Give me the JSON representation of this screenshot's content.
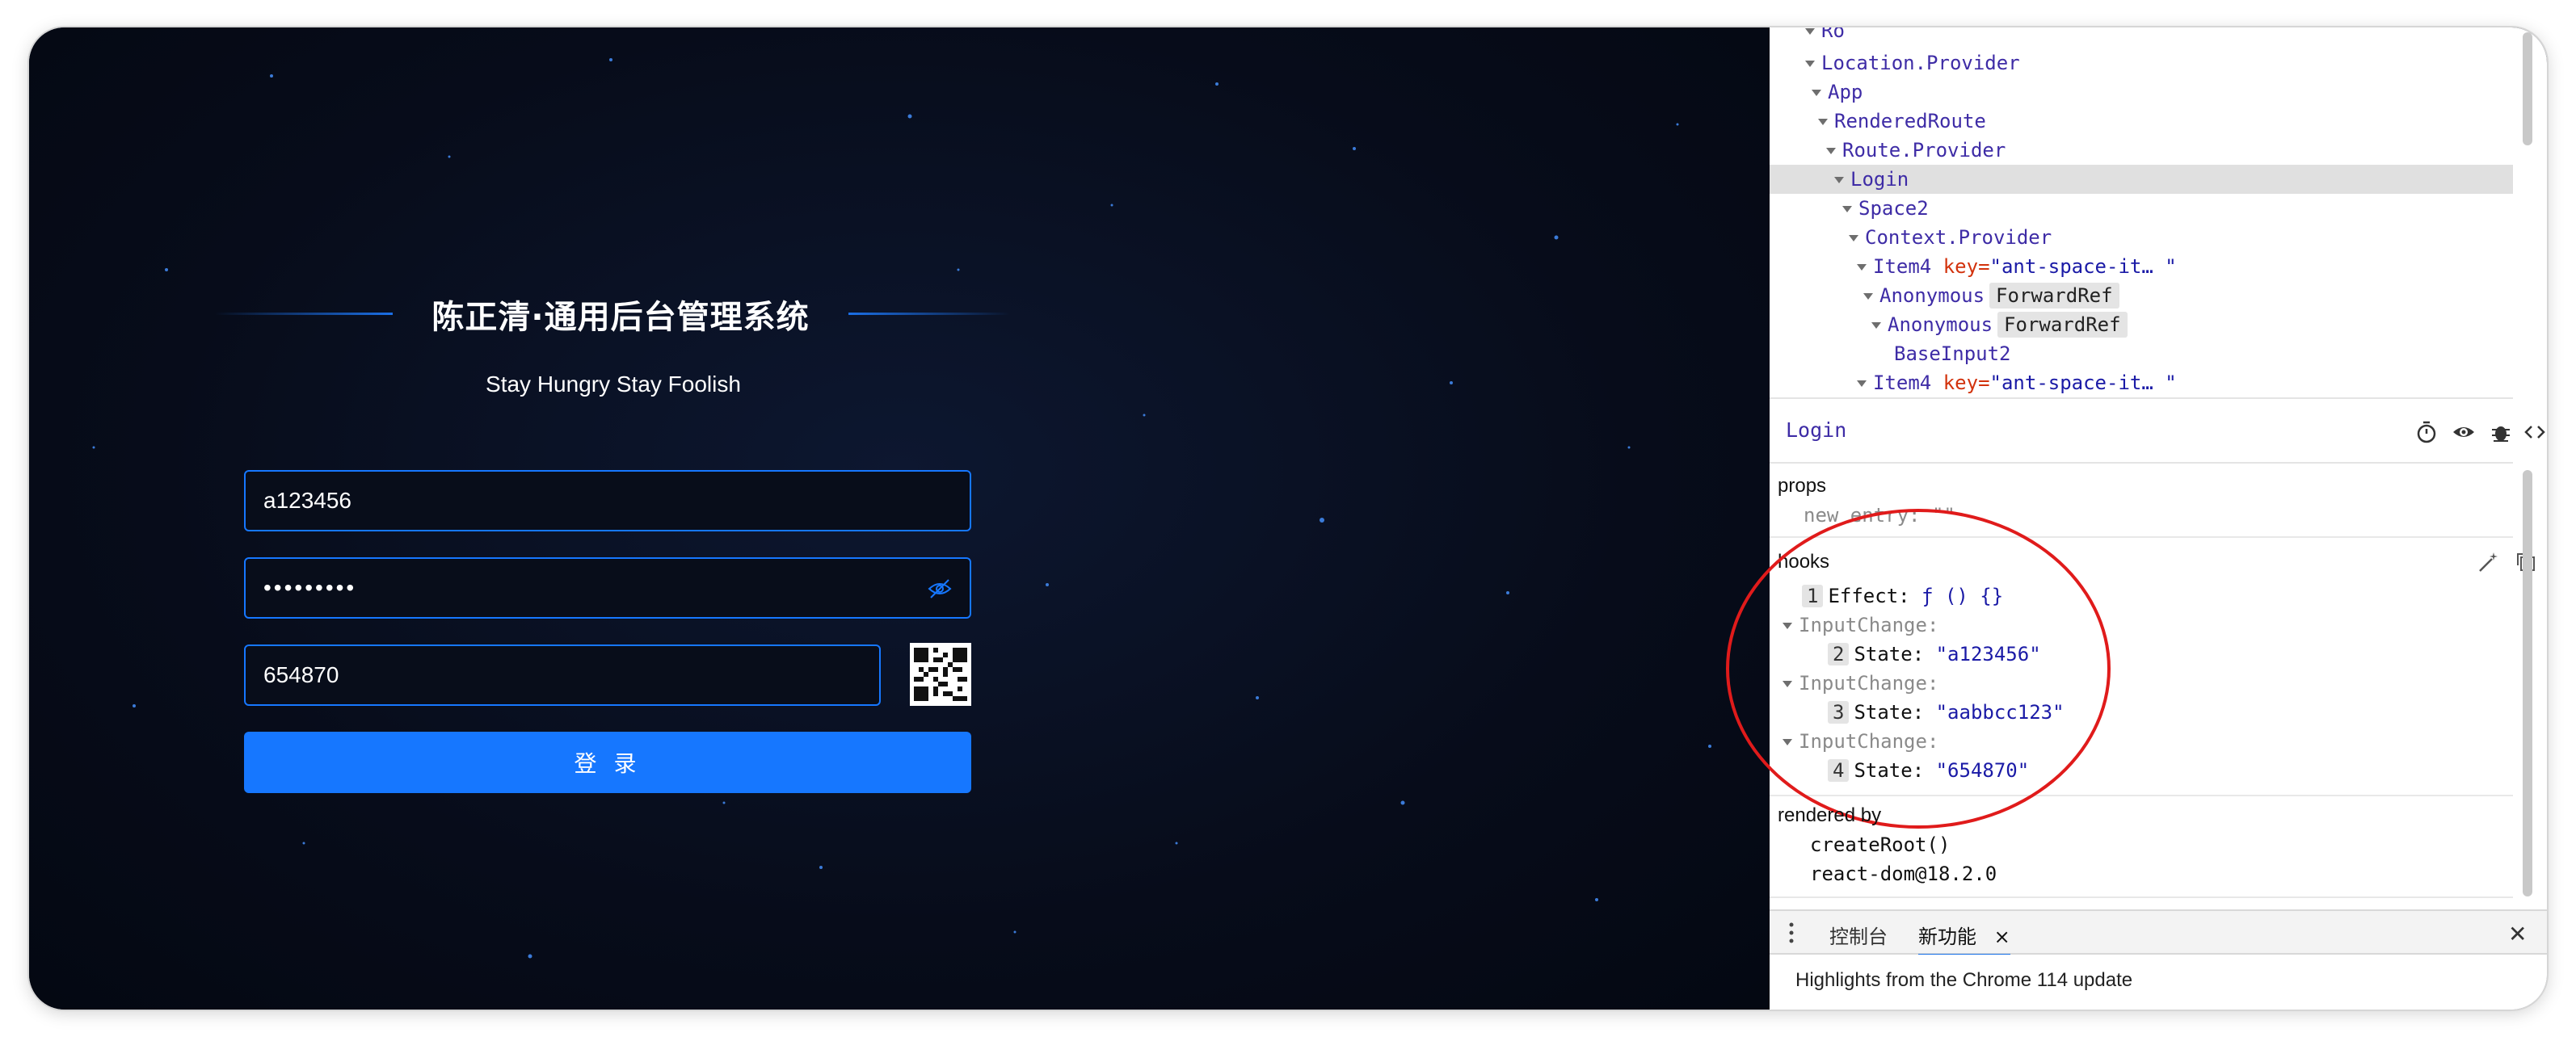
{
  "login": {
    "title": "陈正清·通用后台管理系统",
    "subtitle": "Stay Hungry Stay Foolish",
    "username_value": "a123456",
    "password_mask": "•••••••••",
    "captcha_value": "654870",
    "submit_label": "登 录",
    "accent_color": "#1677ff"
  },
  "devtools": {
    "tree": [
      {
        "label": "Location.Provider"
      },
      {
        "label": "App"
      },
      {
        "label": "RenderedRoute"
      },
      {
        "label": "Route.Provider"
      },
      {
        "label": "Login"
      },
      {
        "label": "Space2"
      },
      {
        "label": "Context.Provider"
      },
      {
        "label": "Item4",
        "key_name": "key",
        "key_value": "\"ant-space-it… \""
      },
      {
        "label": "Anonymous",
        "badge": "ForwardRef"
      },
      {
        "label": "Anonymous",
        "badge": "ForwardRef"
      },
      {
        "label": "BaseInput2"
      },
      {
        "label": "Item4",
        "key_name": "key",
        "key_value": "\"ant-space-it… \""
      }
    ],
    "inspected": {
      "name": "Login",
      "props_label": "props",
      "props_line": "new entry: \"\"",
      "hooks_label": "hooks",
      "hooks": [
        {
          "num": "1",
          "key": "Effect:",
          "value": "ƒ () {}"
        },
        {
          "group": "InputChange:"
        },
        {
          "num": "2",
          "key": "State:",
          "value": "\"a123456\""
        },
        {
          "group": "InputChange:"
        },
        {
          "num": "3",
          "key": "State:",
          "value": "\"aabbcc123\""
        },
        {
          "group": "InputChange:"
        },
        {
          "num": "4",
          "key": "State:",
          "value": "\"654870\""
        }
      ],
      "rendered_by_label": "rendered by",
      "rendered_by": [
        "createRoot()",
        "react-dom@18.2.0"
      ]
    },
    "drawer": {
      "tabs": [
        "控制台",
        "新功能"
      ],
      "active_tab": "新功能",
      "tab_close": "×",
      "close": "✕",
      "content": "Highlights from the Chrome 114 update"
    }
  }
}
